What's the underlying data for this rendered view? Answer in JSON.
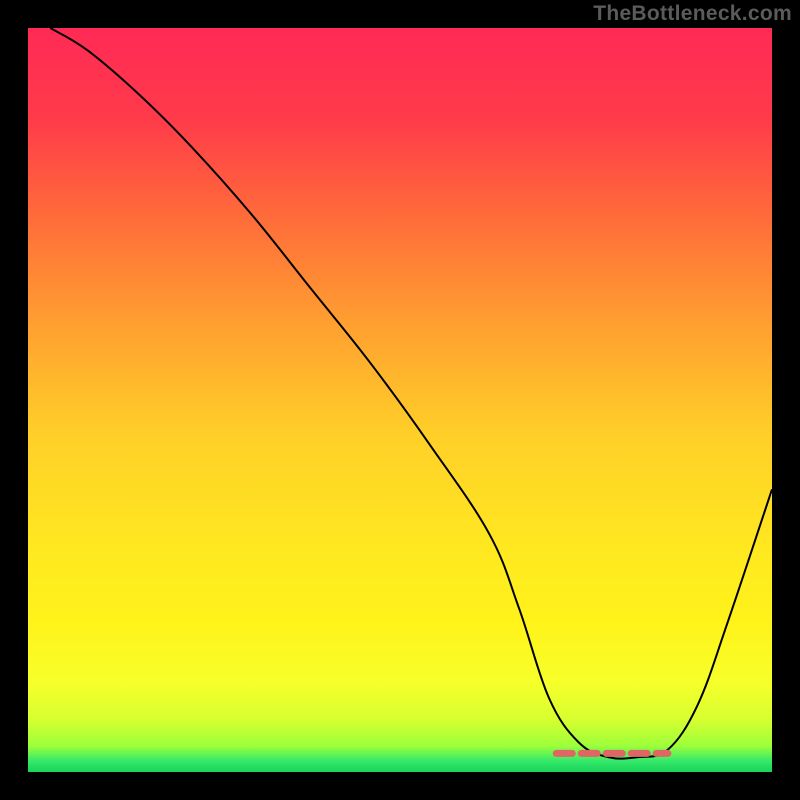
{
  "watermark": "TheBottleneck.com",
  "colors": {
    "black": "#000000",
    "curve": "#000000",
    "segment": "#e06666"
  },
  "gradient_stops": [
    {
      "offset": 0.0,
      "color": "#ff2a55"
    },
    {
      "offset": 0.12,
      "color": "#ff3a4a"
    },
    {
      "offset": 0.25,
      "color": "#ff6a3a"
    },
    {
      "offset": 0.4,
      "color": "#ffa030"
    },
    {
      "offset": 0.55,
      "color": "#ffd028"
    },
    {
      "offset": 0.7,
      "color": "#ffe820"
    },
    {
      "offset": 0.8,
      "color": "#fff31a"
    },
    {
      "offset": 0.88,
      "color": "#f7ff2a"
    },
    {
      "offset": 0.93,
      "color": "#d6ff30"
    },
    {
      "offset": 0.965,
      "color": "#9dff3a"
    },
    {
      "offset": 0.985,
      "color": "#35e96a"
    },
    {
      "offset": 1.0,
      "color": "#18d45a"
    }
  ],
  "chart_data": {
    "type": "line",
    "title": "",
    "xlabel": "",
    "ylabel": "",
    "xlim": [
      0,
      100
    ],
    "ylim": [
      0,
      100
    ],
    "x": [
      3,
      8,
      15,
      22,
      30,
      38,
      46,
      54,
      62,
      66,
      70,
      74,
      78,
      82,
      86,
      90,
      94,
      100
    ],
    "values": [
      100,
      97,
      91,
      84,
      75,
      65,
      55,
      44,
      32,
      22,
      10,
      4,
      2,
      2,
      3,
      9,
      20,
      38
    ],
    "flat_segment": {
      "x_start": 71,
      "x_end": 86,
      "y": 2.5
    },
    "notes": "Curve depicts a bottleneck profile: monotone descent from top-left, minimum plateau near x≈71–86 (highlighted in red), then rises toward the right edge. Values read from pixel positions; axes are unlabeled so x and y are normalized 0–100."
  }
}
